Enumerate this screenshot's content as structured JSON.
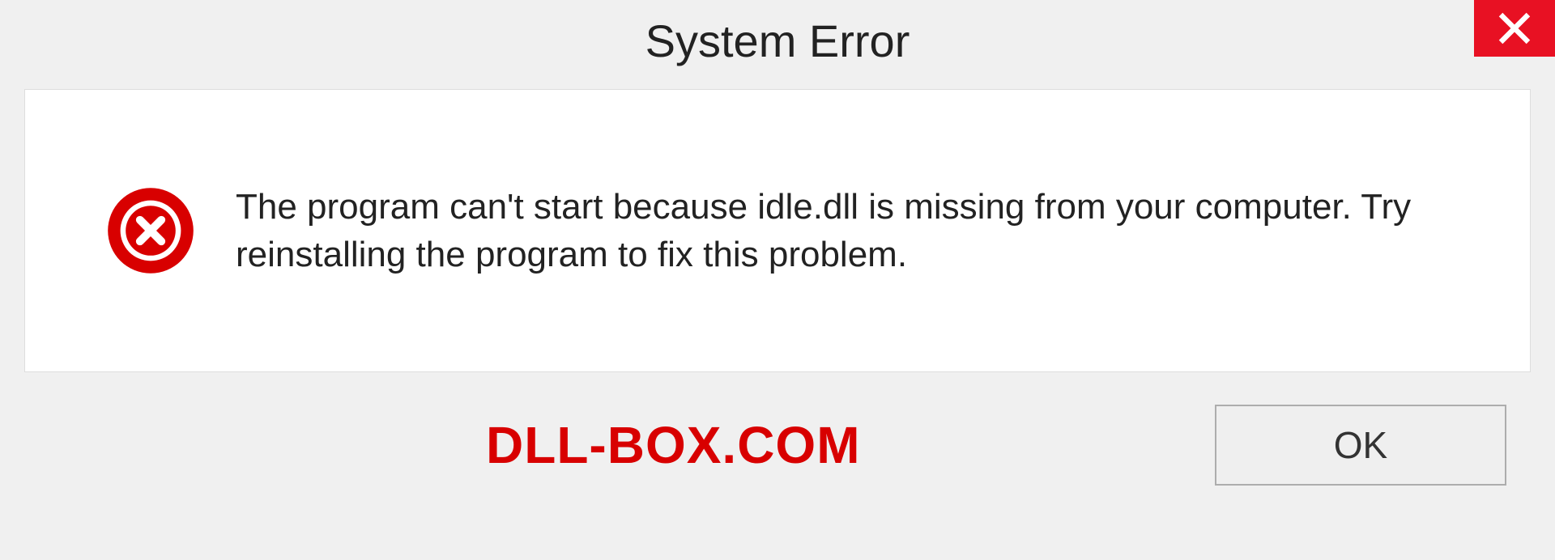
{
  "titlebar": {
    "title": "System Error"
  },
  "message": {
    "text": "The program can't start because idle.dll is missing from your computer. Try reinstalling the program to fix this problem."
  },
  "watermark": {
    "text": "DLL-BOX.COM"
  },
  "buttons": {
    "ok_label": "OK"
  }
}
